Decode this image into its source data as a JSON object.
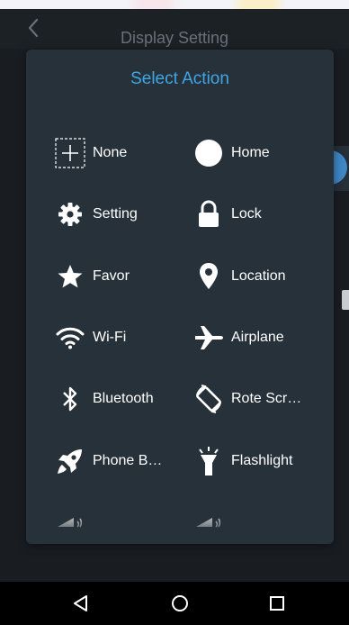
{
  "header": {
    "title": "Display Setting",
    "back_icon": "chevron-left-icon"
  },
  "dialog": {
    "title": "Select Action",
    "actions": [
      {
        "label": "None",
        "icon": "add-box-icon"
      },
      {
        "label": "Home",
        "icon": "circle-icon"
      },
      {
        "label": "Setting",
        "icon": "gear-icon"
      },
      {
        "label": "Lock",
        "icon": "lock-icon"
      },
      {
        "label": "Favor",
        "icon": "star-icon"
      },
      {
        "label": "Location",
        "icon": "location-pin-icon"
      },
      {
        "label": "Wi-Fi",
        "icon": "wifi-icon"
      },
      {
        "label": "Airplane",
        "icon": "airplane-icon"
      },
      {
        "label": "Bluetooth",
        "icon": "bluetooth-icon"
      },
      {
        "label": "Rote Scr…",
        "icon": "rotate-screen-icon"
      },
      {
        "label": "Phone B…",
        "icon": "rocket-icon"
      },
      {
        "label": "Flashlight",
        "icon": "flashlight-icon"
      }
    ]
  },
  "navbar": {
    "back_icon": "triangle-back-icon",
    "home_icon": "circle-home-icon",
    "recents_icon": "square-recents-icon"
  },
  "colors": {
    "accent": "#3fa6e6",
    "dialog_bg": "#27313a",
    "toggle_on": "#3f87c7"
  }
}
